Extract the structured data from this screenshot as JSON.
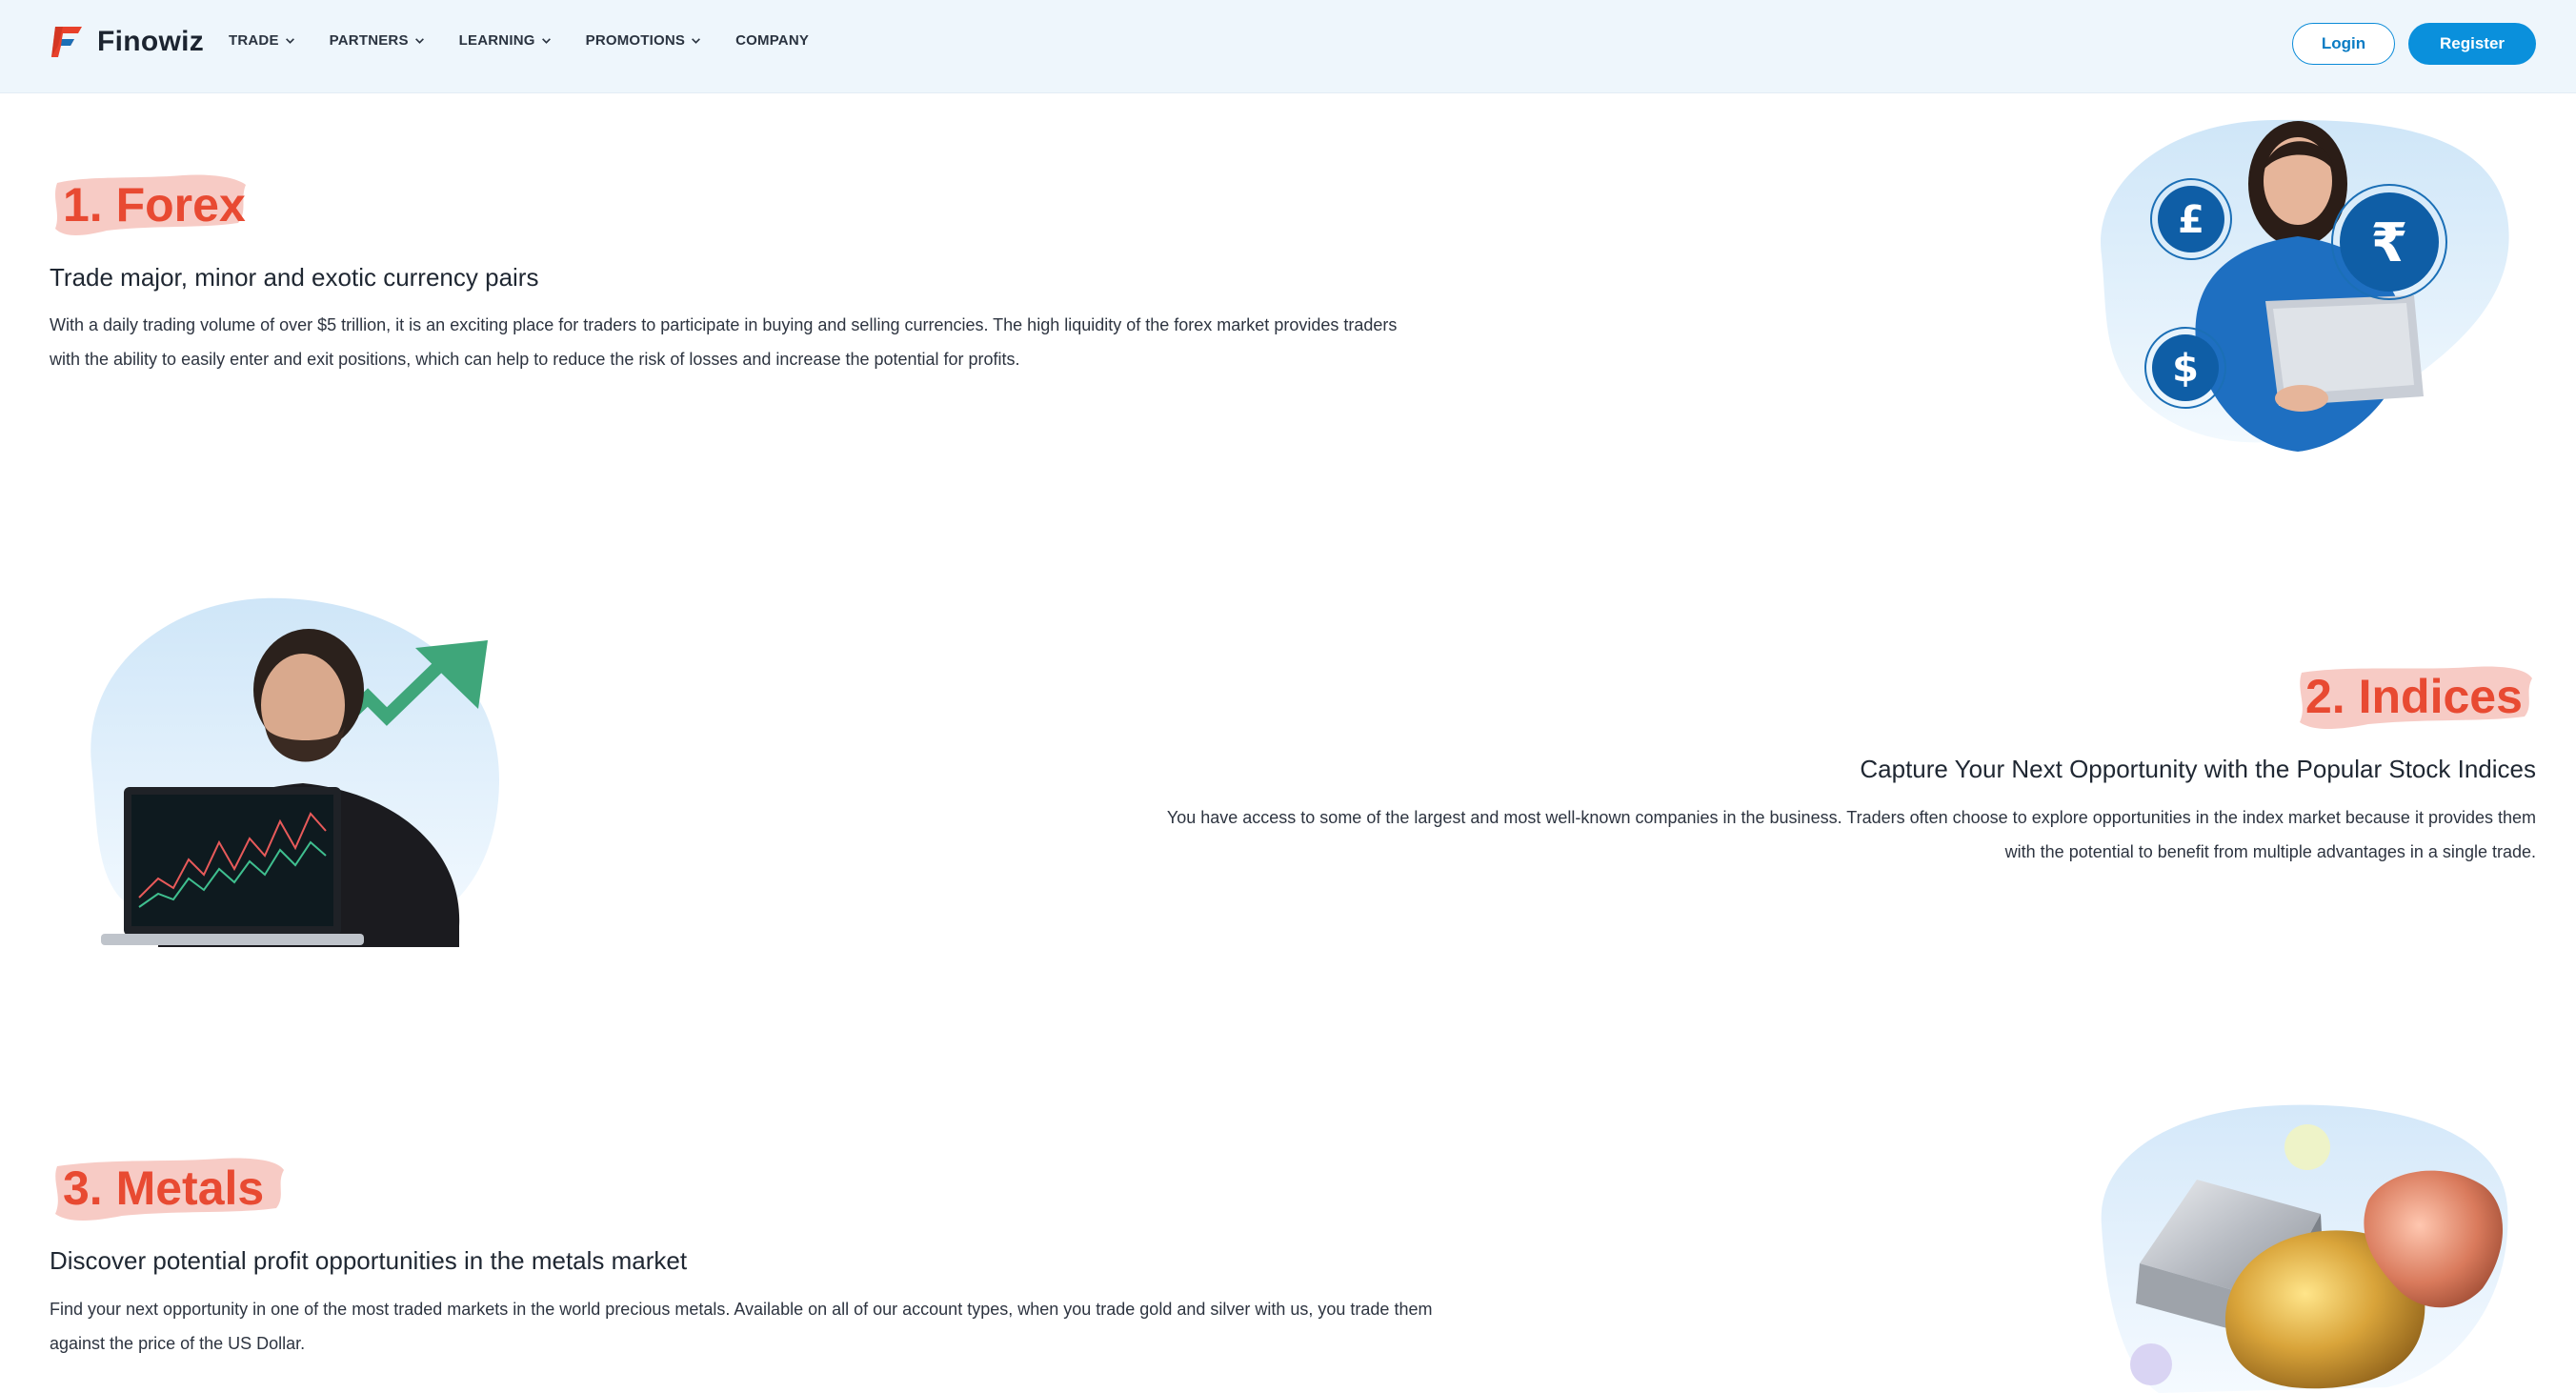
{
  "header": {
    "logo_text": "Finowiz",
    "nav": [
      {
        "label": "TRADE",
        "has_dropdown": true
      },
      {
        "label": "PARTNERS",
        "has_dropdown": true
      },
      {
        "label": "LEARNING",
        "has_dropdown": true
      },
      {
        "label": "PROMOTIONS",
        "has_dropdown": true
      },
      {
        "label": "COMPANY",
        "has_dropdown": false
      }
    ],
    "login_label": "Login",
    "register_label": "Register"
  },
  "sections": [
    {
      "title": "1. Forex",
      "subtitle": "Trade major, minor and exotic currency pairs",
      "body_line1": "With a daily trading volume of over $5 trillion, it is an exciting place for traders to participate in buying and selling currencies. The high liquidity of the forex market provides traders",
      "body_line2": "with the ability to easily enter and exit positions, which can help to reduce the risk of losses and increase the potential for profits.",
      "image": "woman-with-laptop-and-currency-coins",
      "coins": [
        "£",
        "₹",
        "$"
      ]
    },
    {
      "title": "2. Indices",
      "subtitle": "Capture Your Next Opportunity with the Popular Stock Indices",
      "body_line1": "You have access to some of the largest and most well-known companies in the business. Traders often choose to explore opportunities in the index market because it provides them",
      "body_line2": "with the potential to benefit from multiple advantages in a single trade.",
      "image": "man-with-laptop-and-growth-arrow"
    },
    {
      "title": "3. Metals",
      "subtitle": "Discover potential profit opportunities in the metals market",
      "body_line1": "Find your next opportunity in one of the most traded markets in the world precious metals. Available on all of our account types, when you trade gold and silver with us, you trade them",
      "body_line2": "against the price of the US Dollar.",
      "image": "silver-bar-gold-and-copper-nuggets"
    }
  ],
  "colors": {
    "accent_red": "#e84a32",
    "brush_pink": "#f6c2bb",
    "primary_blue": "#0a90dc",
    "header_bg": "#eef6fc"
  }
}
